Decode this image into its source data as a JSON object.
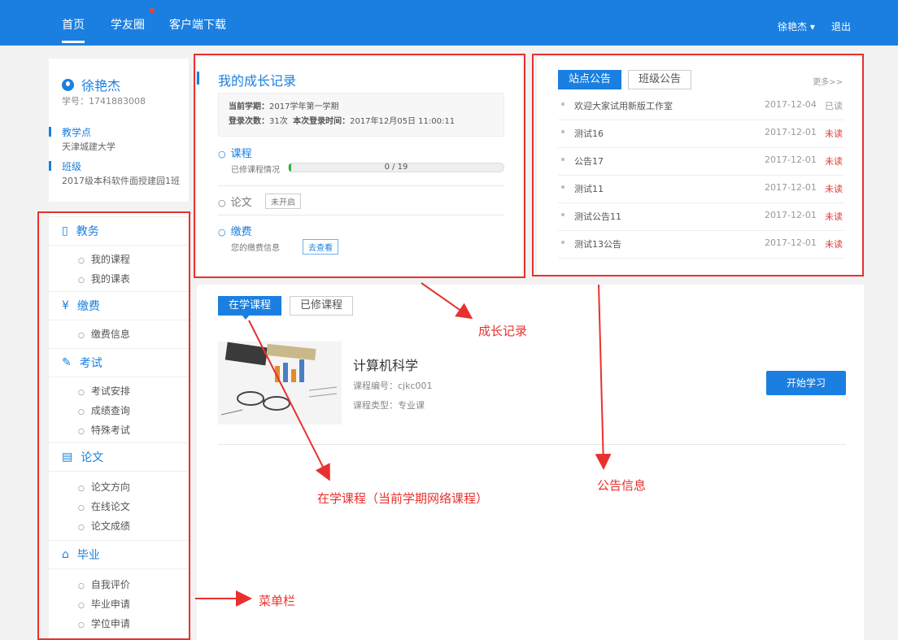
{
  "nav": {
    "items": [
      "首页",
      "学友圈",
      "客户端下载"
    ],
    "user_name": "徐艳杰 ▾",
    "logout": "退出"
  },
  "profile": {
    "name": "徐艳杰",
    "student_id": "学号：1741883008",
    "site_label": "教学点",
    "site_value": "天津城建大学",
    "class_label": "班级",
    "class_value": "2017级本科软件面授建园1班"
  },
  "menu": {
    "sections": [
      {
        "title": "教务",
        "icon": "academic-icon",
        "items": [
          "我的课程",
          "我的课表"
        ]
      },
      {
        "title": "缴费",
        "icon": "yuan-icon",
        "items": [
          "缴费信息"
        ]
      },
      {
        "title": "考试",
        "icon": "pencil-icon",
        "items": [
          "考试安排",
          "成绩查询",
          "特殊考试"
        ]
      },
      {
        "title": "论文",
        "icon": "document-icon",
        "items": [
          "论文方向",
          "在线论文",
          "论文成绩"
        ]
      },
      {
        "title": "毕业",
        "icon": "graduation-cap-icon",
        "items": [
          "自我评价",
          "毕业申请",
          "学位申请"
        ]
      }
    ]
  },
  "growth": {
    "title": "我的成长记录",
    "semester_label": "当前学期：",
    "semester_value": "2017学年第一学期",
    "login_label": "登录次数：",
    "login_value": "31次",
    "this_login_label": "本次登录时间：",
    "this_login_value": "2017年12月05日 11:00:11",
    "course_title": "课程",
    "course_progress_label": "已修课程情况",
    "course_progress_text": "0 / 19",
    "course_progress_fraction": 0.0,
    "thesis_title": "论文",
    "thesis_status": "未开启",
    "fee_title": "缴费",
    "fee_label": "您的缴费信息",
    "fee_button": "去查看"
  },
  "notices": {
    "tabs": [
      "站点公告",
      "班级公告"
    ],
    "more": "更多>>",
    "rows": [
      {
        "title": "欢迎大家试用新版工作室",
        "date": "2017-12-04",
        "status": "已读"
      },
      {
        "title": "测试16",
        "date": "2017-12-01",
        "status": "未读"
      },
      {
        "title": "公告17",
        "date": "2017-12-01",
        "status": "未读"
      },
      {
        "title": "测试11",
        "date": "2017-12-01",
        "status": "未读"
      },
      {
        "title": "测试公告11",
        "date": "2017-12-01",
        "status": "未读"
      },
      {
        "title": "测试13公告",
        "date": "2017-12-01",
        "status": "未读"
      }
    ]
  },
  "courses": {
    "tabs": [
      "在学课程",
      "已修课程"
    ],
    "course_name": "计算机科学",
    "course_code": "课程编号：cjkc001",
    "course_type": "课程类型：专业课",
    "start_button": "开始学习"
  },
  "annotations": {
    "growth": "成长记录",
    "current_courses": "在学课程（当前学期网络课程）",
    "notices": "公告信息",
    "menu": "菜单栏"
  },
  "colors": {
    "primary": "#1a7fe0",
    "annotation_red": "#e8312f",
    "unread_red": "#e53935",
    "progress_green": "#34b334"
  }
}
